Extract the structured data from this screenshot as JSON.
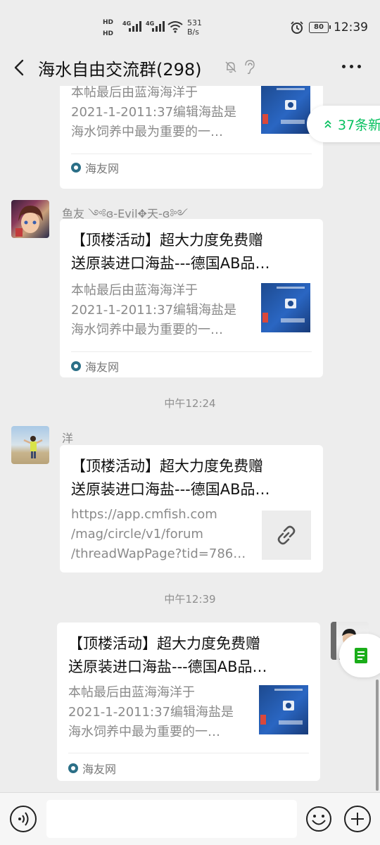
{
  "status_bar": {
    "hd1": "HD",
    "hd2": "HD",
    "sim1_network": "4G",
    "sim2_network": "4G",
    "speed_value": "531",
    "speed_unit": "B/s",
    "battery": "80",
    "time": "12:39",
    "icons": [
      "signal-icon",
      "wifi-icon",
      "alarm-icon",
      "battery-icon"
    ]
  },
  "header": {
    "title": "海水自由交流群(298)",
    "icons": [
      "back-icon",
      "mute-icon",
      "ear-icon",
      "more-icon"
    ]
  },
  "new_messages": {
    "label": "37条新"
  },
  "messages": [
    {
      "type": "article",
      "title_lines": [],
      "desc_lines": [
        "本帖最后由蓝海海洋于",
        "2021-1-2011:37编辑海盐是",
        "海水饲养中最为重要的一…"
      ],
      "source": "海友网"
    },
    {
      "type": "article",
      "sender": "鱼友 ༺ɞ-Evil✥天-ɞ༻",
      "title_lines": [
        "【顶楼活动】超大力度免费赠",
        "送原装进口海盐---德国AB品…"
      ],
      "desc_lines": [
        "本帖最后由蓝海海洋于",
        "2021-1-2011:37编辑海盐是",
        "海水饲养中最为重要的一…"
      ],
      "source": "海友网"
    },
    {
      "type": "link",
      "timestamp": "中午12:24",
      "sender": "洋",
      "title_lines": [
        "【顶楼活动】超大力度免费赠",
        "送原装进口海盐---德国AB品…"
      ],
      "desc_lines": [
        "https://app.cmfish.com",
        "/mag/circle/v1/forum",
        "/threadWapPage?tid=786…"
      ]
    },
    {
      "type": "article",
      "timestamp": "中午12:39",
      "title_lines": [
        "【顶楼活动】超大力度免费赠",
        "送原装进口海盐---德国AB品…"
      ],
      "desc_lines": [
        "本帖最后由蓝海海洋于",
        "2021-1-2011:37编辑海盐是",
        "海水饲养中最为重要的一…"
      ],
      "source": "海友网"
    }
  ],
  "input_bar": {
    "placeholder": "",
    "icons": [
      "voice-icon",
      "emoji-icon",
      "plus-icon"
    ]
  },
  "colors": {
    "accent": "#07c160",
    "background": "#ededed",
    "card": "#ffffff"
  }
}
